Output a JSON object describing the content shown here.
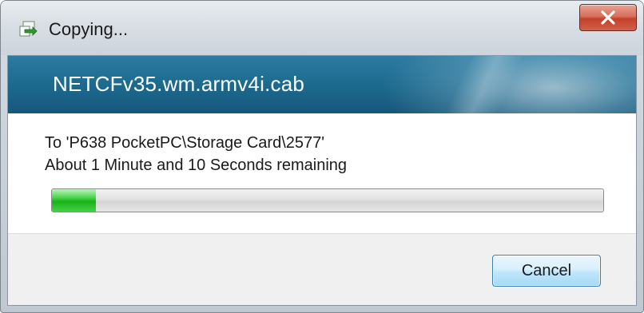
{
  "window": {
    "title": "Copying..."
  },
  "banner": {
    "filename": "NETCFv35.wm.armv4i.cab"
  },
  "status": {
    "destination": "To 'P638 PocketPC\\Storage Card\\2577'",
    "time_remaining": "About 1 Minute and 10 Seconds remaining"
  },
  "progress": {
    "percent": 8
  },
  "buttons": {
    "cancel_label": "Cancel"
  },
  "icons": {
    "title": "copy-files-icon",
    "close": "close-icon"
  },
  "colors": {
    "banner": "#1d6a8f",
    "progress_fill": "#17b317",
    "close_button": "#c5402a"
  }
}
